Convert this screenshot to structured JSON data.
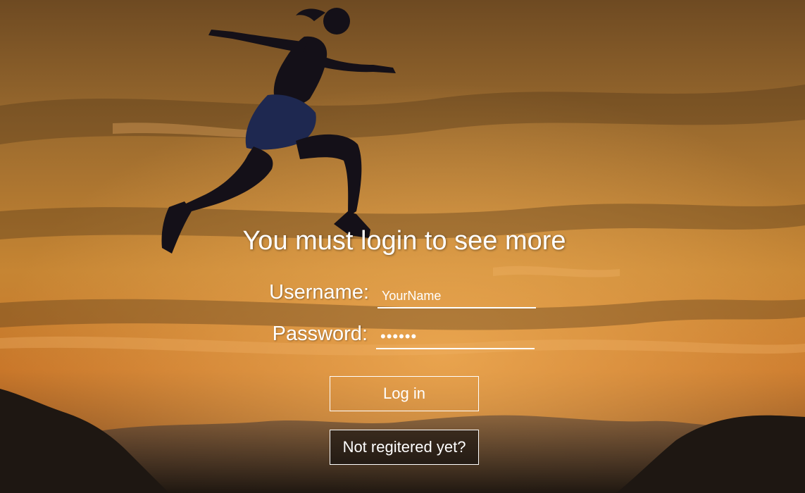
{
  "page": {
    "headline": "You must login to see more"
  },
  "form": {
    "username_label": "Username:",
    "username_value": "YourName",
    "password_label": "Password:",
    "password_value": "••••••"
  },
  "buttons": {
    "login_label": "Log in",
    "register_label": "Not regitered yet?"
  },
  "background": {
    "description_icon": "runner-silhouette-sunset",
    "sky_color_top": "#8a5a22",
    "sky_color_mid": "#c8862f",
    "mountain_color": "#1c1612"
  }
}
